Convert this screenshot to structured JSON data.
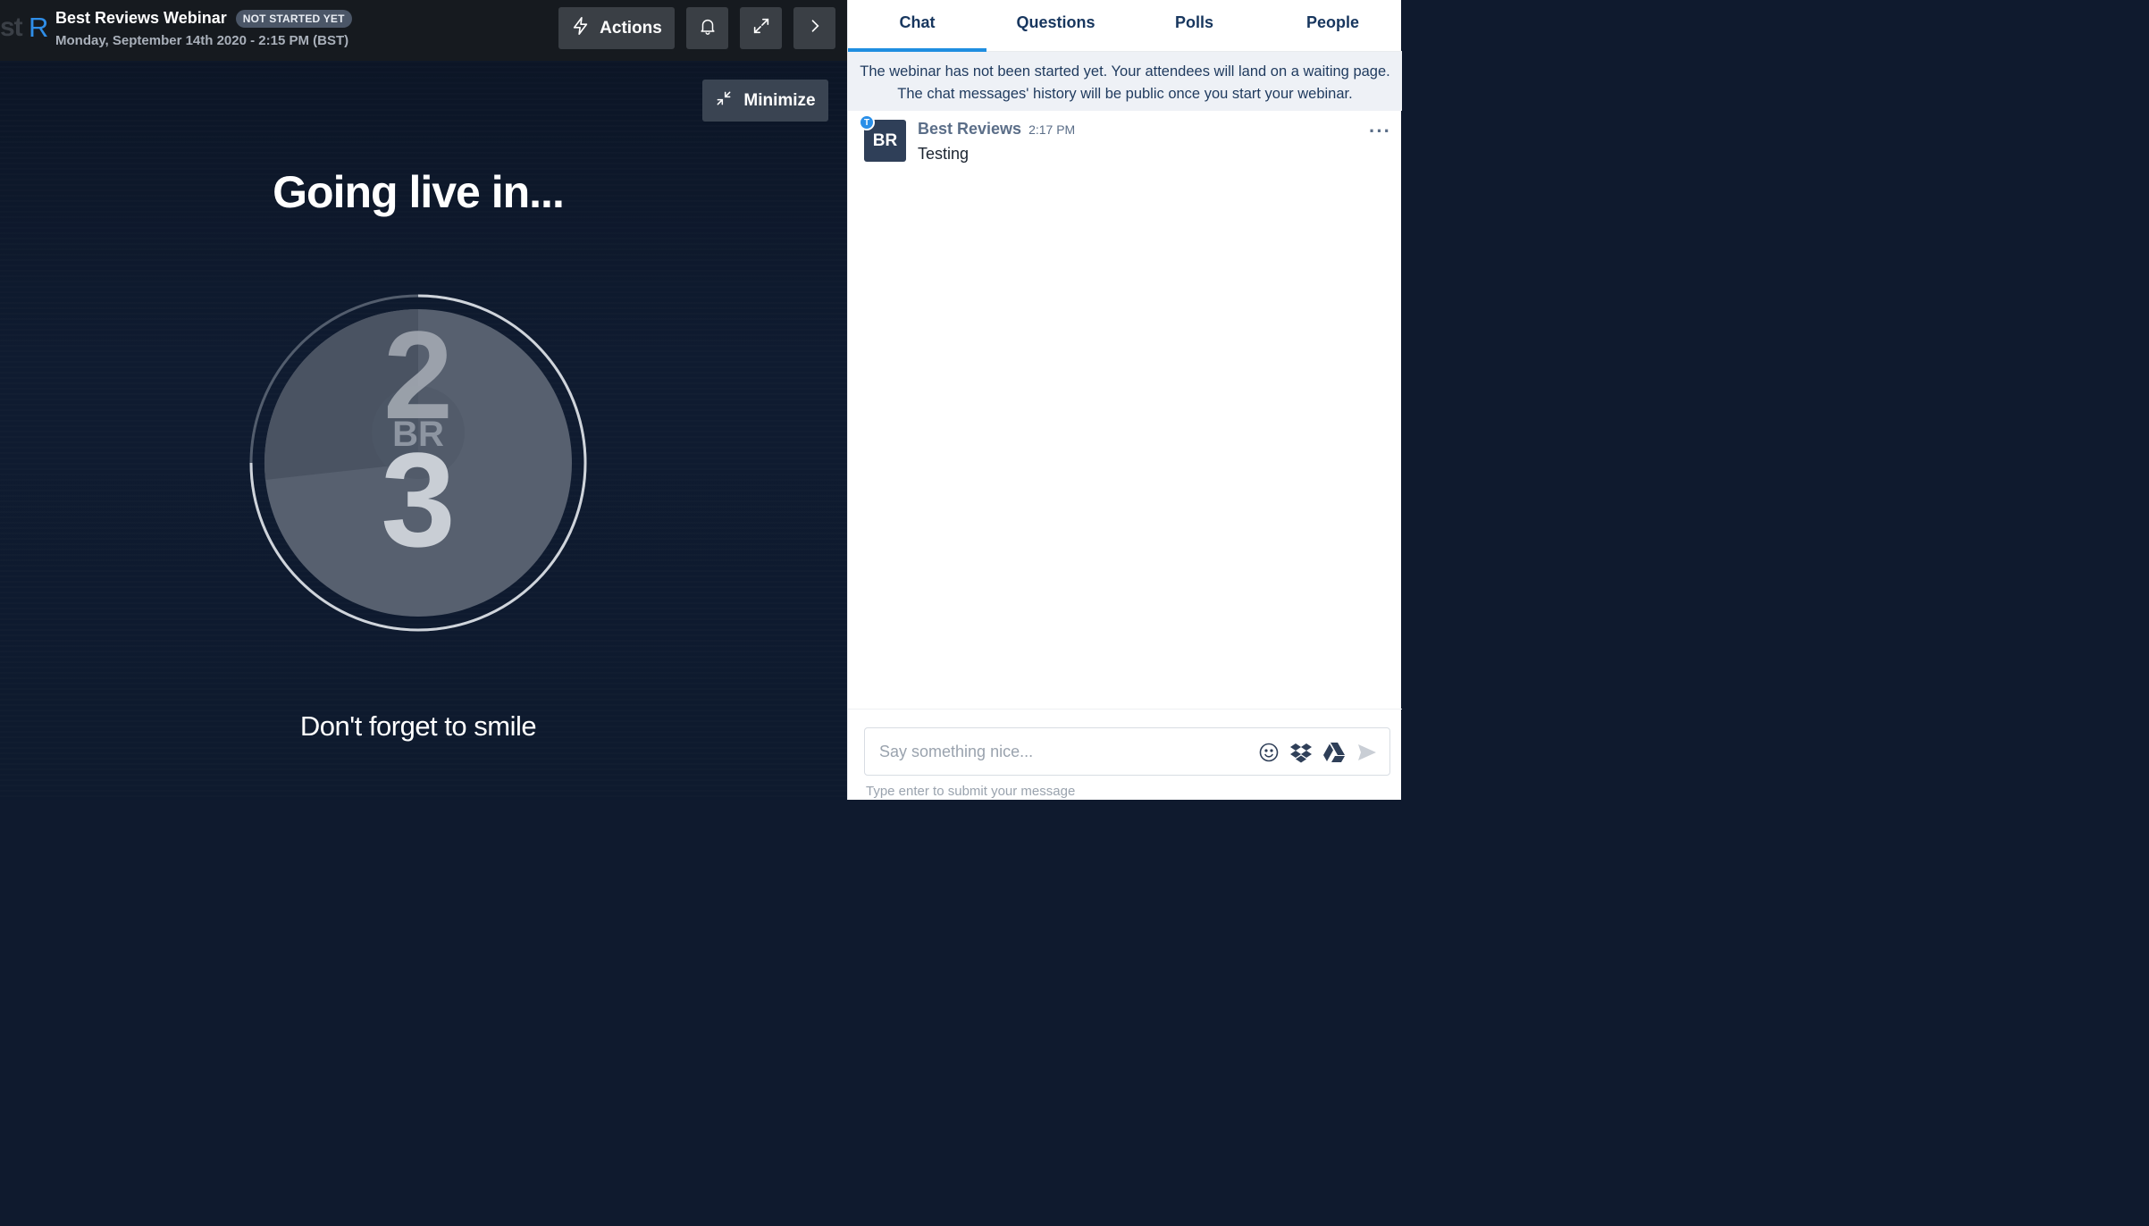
{
  "header": {
    "brand_fragment": "st",
    "brand_letter": "R",
    "title": "Best Reviews Webinar",
    "status": "NOT STARTED YET",
    "date": "Monday, September 14th 2020 - 2:15 PM (BST)",
    "actions_label": "Actions"
  },
  "stage": {
    "minimize_label": "Minimize",
    "heading": "Going live in...",
    "countdown_prev": "2",
    "countdown_current": "3",
    "countdown_initials": "BR",
    "footer_text": "Don't forget to smile"
  },
  "panel": {
    "tabs": [
      {
        "label": "Chat"
      },
      {
        "label": "Questions"
      },
      {
        "label": "Polls"
      },
      {
        "label": "People"
      }
    ],
    "notice": "The webinar has not been started yet. Your attendees will land on a waiting page. The chat messages' history will be public once you start your webinar.",
    "messages": [
      {
        "avatar": "BR",
        "badge": "T",
        "author": "Best Reviews",
        "time": "2:17 PM",
        "text": "Testing",
        "more": "···"
      }
    ],
    "composer": {
      "placeholder": "Say something nice...",
      "hint": "Type enter to submit your message"
    }
  },
  "colors": {
    "accent": "#1f8ee0",
    "brand": "#2f8ee8",
    "tab_text": "#17365e",
    "topbar": "#161a1f"
  },
  "icons": [
    "lightning-icon",
    "bell-icon",
    "expand-icon",
    "chevron-right-icon",
    "minimize-icon",
    "emoji-icon",
    "dropbox-icon",
    "google-drive-icon",
    "send-icon"
  ]
}
